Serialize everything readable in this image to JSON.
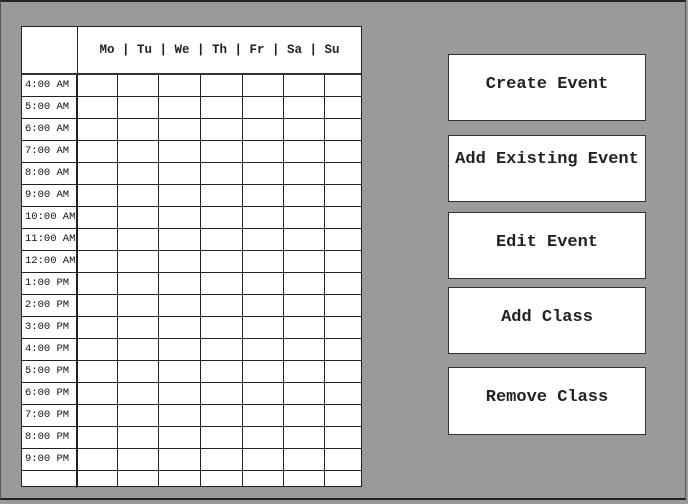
{
  "calendar": {
    "days_header": "Mo | Tu | We | Th | Fr | Sa | Su",
    "days": [
      "Mo",
      "Tu",
      "We",
      "Th",
      "Fr",
      "Sa",
      "Su"
    ],
    "times": [
      "4:00 AM",
      "5:00 AM",
      "6:00 AM",
      "7:00 AM",
      "8:00 AM",
      "9:00 AM",
      "10:00 AM",
      "11:00 AM",
      "12:00 AM",
      "1:00 PM",
      "2:00 PM",
      "3:00 PM",
      "4:00 PM",
      "5:00 PM",
      "6:00 PM",
      "7:00 PM",
      "8:00 PM",
      "9:00 PM"
    ]
  },
  "buttons": {
    "create_event": "Create Event",
    "add_existing_event": "Add Existing Event",
    "edit_event": "Edit Event",
    "add_class": "Add Class",
    "remove_class": "Remove Class"
  }
}
